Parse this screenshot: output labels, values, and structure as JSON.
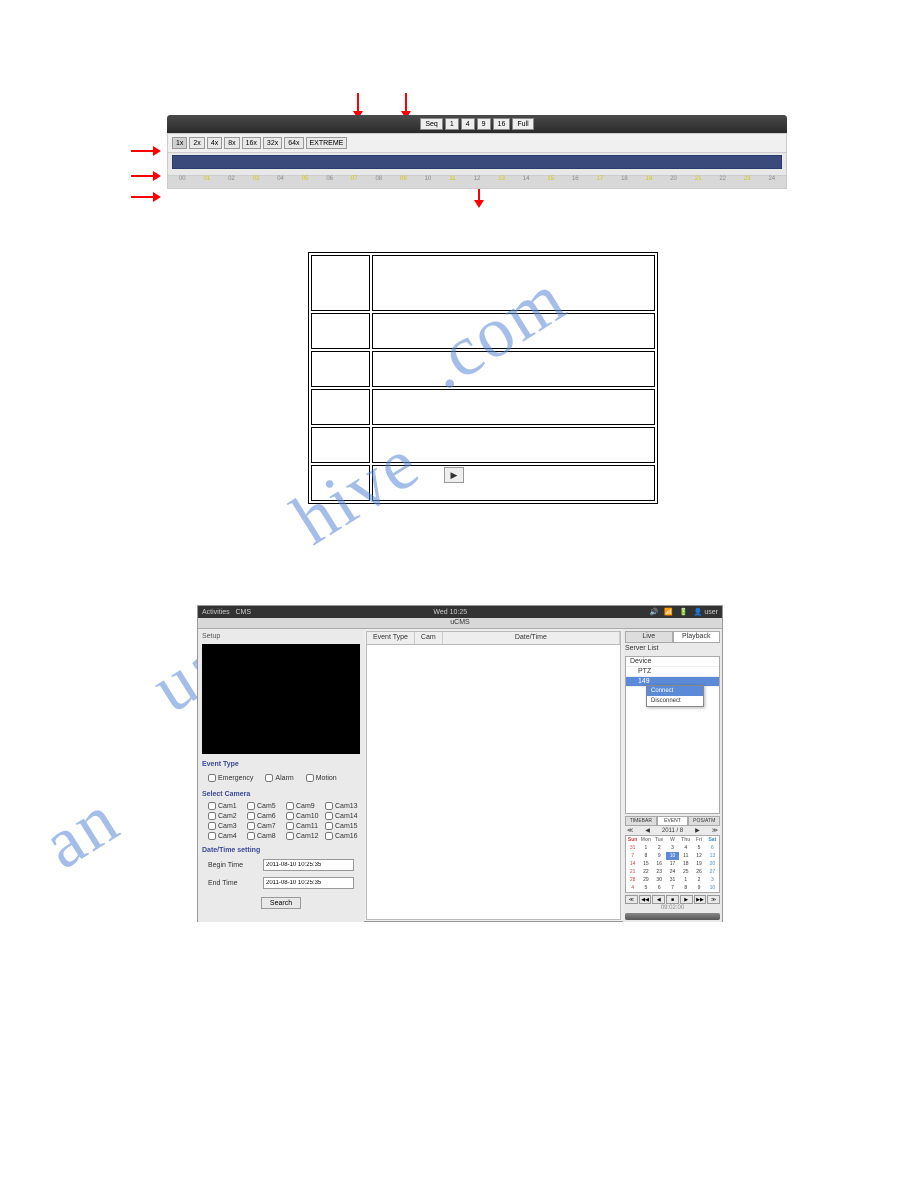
{
  "topbar": {
    "buttons": [
      "Seq",
      "1",
      "4",
      "9",
      "16",
      "Full"
    ]
  },
  "speed": {
    "buttons": [
      "1x",
      "2x",
      "4x",
      "8x",
      "16x",
      "32x",
      "64x",
      "EXTREME"
    ]
  },
  "ruler": [
    "00",
    "01",
    "02",
    "03",
    "04",
    "05",
    "06",
    "07",
    "08",
    "09",
    "10",
    "11",
    "12",
    "13",
    "14",
    "15",
    "16",
    "17",
    "18",
    "19",
    "20",
    "21",
    "22",
    "23",
    "24"
  ],
  "cms": {
    "top": {
      "left1": "Activities",
      "left2": "CMS",
      "center": "Wed 10:25",
      "right": "user",
      "title": "uCMS"
    },
    "left": {
      "setup": "Setup",
      "event_type": "Event Type",
      "event_opts": [
        "Emergency",
        "Alarm",
        "Motion"
      ],
      "sel_cam": "Select Camera",
      "cams": [
        "Cam1",
        "Cam5",
        "Cam9",
        "Cam13",
        "Cam2",
        "Cam6",
        "Cam10",
        "Cam14",
        "Cam3",
        "Cam7",
        "Cam11",
        "Cam15",
        "Cam4",
        "Cam8",
        "Cam12",
        "Cam16"
      ],
      "dt": "Date/Time setting",
      "begin": "Begin Time",
      "end": "End Time",
      "dt1": "2011-08-10 10:25:35",
      "dt2": "2011-08-10 10:25:35",
      "search": "Search"
    },
    "mid": {
      "c1": "Event Type",
      "c2": "Cam",
      "c3": "Date/Time"
    },
    "right": {
      "tabs": [
        "Live",
        "Playback"
      ],
      "sl": "Server List",
      "dev": "Device",
      "ptz": "PTZ",
      "sel": "149",
      "ctx": [
        "Connect",
        "Disconnect"
      ],
      "tabs2": [
        "TIMEBAR",
        "EVENT",
        "POS/ATM"
      ],
      "month": "2011 / 8",
      "dow": [
        "Sun",
        "Mon",
        "Tue",
        "W",
        "Thu",
        "Fri",
        "Sat"
      ],
      "cal": [
        [
          "31",
          "1",
          "2",
          "3",
          "4",
          "5",
          "6"
        ],
        [
          "7",
          "8",
          "9",
          "10",
          "11",
          "12",
          "13"
        ],
        [
          "14",
          "15",
          "16",
          "17",
          "18",
          "19",
          "20"
        ],
        [
          "21",
          "22",
          "23",
          "24",
          "25",
          "26",
          "27"
        ],
        [
          "28",
          "29",
          "30",
          "31",
          "1",
          "2",
          "3"
        ],
        [
          "4",
          "5",
          "6",
          "7",
          "8",
          "9",
          "10"
        ]
      ],
      "pb": [
        "≪",
        "◀◀",
        "◀",
        "■",
        "▶",
        "▶▶",
        "≫"
      ],
      "tc": "09:02:00"
    }
  }
}
